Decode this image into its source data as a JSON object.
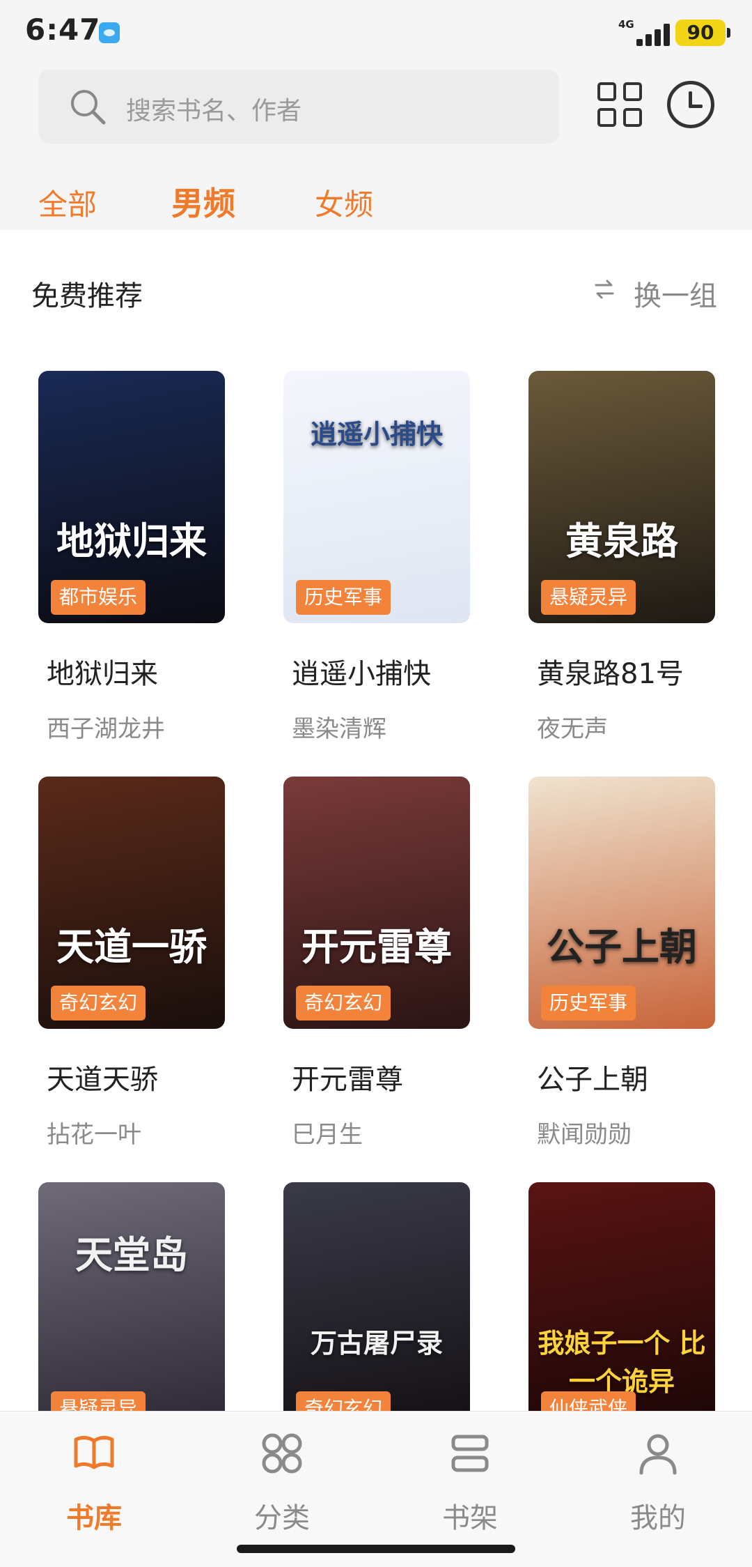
{
  "status_bar": {
    "time": "6:47",
    "network": "4G",
    "battery": "90"
  },
  "search": {
    "placeholder": "搜索书名、作者"
  },
  "tabs": [
    {
      "label": "全部",
      "active": false
    },
    {
      "label": "男频",
      "active": true
    },
    {
      "label": "女频",
      "active": false
    }
  ],
  "section": {
    "title": "免费推荐",
    "refresh_label": "换一组"
  },
  "books": [
    {
      "title": "地狱归来",
      "author": "西子湖龙井",
      "tag": "都市娱乐",
      "cover_text": "地狱归来",
      "palette": [
        "#1a2a55",
        "#0b0b12"
      ]
    },
    {
      "title": "逍遥小捕快",
      "author": "墨染清辉",
      "tag": "历史军事",
      "cover_text": "逍遥小捕快",
      "palette": [
        "#f4f6fb",
        "#dfe6f2"
      ]
    },
    {
      "title": "黄泉路81号",
      "author": "夜无声",
      "tag": "悬疑灵异",
      "cover_text": "黄泉路",
      "palette": [
        "#6b5a3a",
        "#1e1a14"
      ]
    },
    {
      "title": "天道天骄",
      "author": "拈花一叶",
      "tag": "奇幻玄幻",
      "cover_text": "天道一骄",
      "palette": [
        "#5a2a1a",
        "#1a0f0c"
      ]
    },
    {
      "title": "开元雷尊",
      "author": "巳月生",
      "tag": "奇幻玄幻",
      "cover_text": "开元雷尊",
      "palette": [
        "#7a3a3a",
        "#2a1414"
      ]
    },
    {
      "title": "公子上朝",
      "author": "默闻勋勋",
      "tag": "历史军事",
      "cover_text": "公子上朝",
      "palette": [
        "#efe3cf",
        "#c8643a"
      ]
    },
    {
      "title": "天堂岛",
      "author": "",
      "tag": "悬疑灵异",
      "cover_text": "天堂岛",
      "palette": [
        "#6f6a78",
        "#2a2632"
      ]
    },
    {
      "title": "万古屠尸录",
      "author": "",
      "tag": "奇幻玄幻",
      "cover_text": "万古屠尸录",
      "palette": [
        "#3a3a48",
        "#120f12"
      ]
    },
    {
      "title": "我娘子一个比一个诡异",
      "author": "",
      "tag": "仙侠武侠",
      "cover_text": "我娘子一个 比一个诡异",
      "palette": [
        "#5a1414",
        "#1a0606"
      ]
    }
  ],
  "bottom_nav": [
    {
      "label": "书库",
      "icon": "book-open-icon",
      "active": true
    },
    {
      "label": "分类",
      "icon": "category-grid-icon",
      "active": false
    },
    {
      "label": "书架",
      "icon": "bookshelf-icon",
      "active": false
    },
    {
      "label": "我的",
      "icon": "person-icon",
      "active": false
    }
  ],
  "colors": {
    "accent": "#f07a2a",
    "tag_bg": "#f3823b"
  }
}
